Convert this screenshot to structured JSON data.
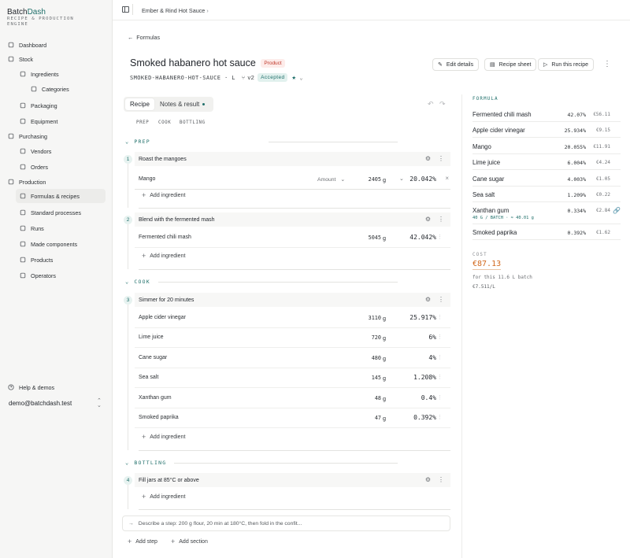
{
  "brand": {
    "name_a": "Batch",
    "name_b": "Dash",
    "subtitle": "RECIPE & PRODUCTION ENGINE"
  },
  "sidebar": {
    "items": [
      {
        "label": "Dashboard",
        "icon": "dashboard-icon"
      },
      {
        "label": "Stock",
        "icon": "box-icon"
      },
      {
        "label": "Ingredients",
        "icon": "leaf-icon"
      },
      {
        "label": "Categories",
        "icon": "tag-icon"
      },
      {
        "label": "Packaging",
        "icon": "package-icon"
      },
      {
        "label": "Equipment",
        "icon": "wrench-icon"
      },
      {
        "label": "Purchasing",
        "icon": "cart-icon"
      },
      {
        "label": "Vendors",
        "icon": "store-icon"
      },
      {
        "label": "Orders",
        "icon": "cart-icon"
      },
      {
        "label": "Production",
        "icon": "factory-icon"
      },
      {
        "label": "Formulas & recipes",
        "icon": "book-icon"
      },
      {
        "label": "Standard processes",
        "icon": "list-icon"
      },
      {
        "label": "Runs",
        "icon": "layers-icon"
      },
      {
        "label": "Made components",
        "icon": "cube-icon"
      },
      {
        "label": "Products",
        "icon": "product-icon"
      },
      {
        "label": "Operators",
        "icon": "users-icon"
      }
    ],
    "help": "Help & demos",
    "user": "demo@batchdash.test"
  },
  "topbar": {
    "breadcrumb": "Ember & Rind Hot Sauce",
    "sep": "›"
  },
  "page": {
    "back": "Formulas",
    "title": "Smoked habanero hot sauce",
    "type_badge": "Product",
    "sku": "SMOKED-HABANERO-HOT-SAUCE · L",
    "version": "v2",
    "status": "Accepted",
    "actions": {
      "edit": "Edit details",
      "sheet": "Recipe sheet",
      "run": "Run this recipe"
    }
  },
  "tabs": {
    "recipe": "Recipe",
    "notes": "Notes & result"
  },
  "jump": [
    "PREP",
    "COOK",
    "BOTTLING"
  ],
  "sections": [
    {
      "name": "PREP",
      "steps": [
        {
          "num": "1",
          "title": "Roast the mangoes",
          "ingredients": [
            {
              "name": "Mango",
              "amount_label": "Amount",
              "amount": "2405",
              "unit": "g",
              "pct": "20.042%"
            }
          ]
        },
        {
          "num": "2",
          "title": "Blend with the fermented mash",
          "ingredients": [
            {
              "name": "Fermented chili mash",
              "amount": "5045",
              "unit": "g",
              "pct": "42.042%"
            }
          ]
        }
      ]
    },
    {
      "name": "COOK",
      "steps": [
        {
          "num": "3",
          "title": "Simmer for 20 minutes",
          "ingredients": [
            {
              "name": "Apple cider vinegar",
              "amount": "3110",
              "unit": "g",
              "pct": "25.917%"
            },
            {
              "name": "Lime juice",
              "amount": "720",
              "unit": "g",
              "pct": "6%"
            },
            {
              "name": "Cane sugar",
              "amount": "480",
              "unit": "g",
              "pct": "4%"
            },
            {
              "name": "Sea salt",
              "amount": "145",
              "unit": "g",
              "pct": "1.208%"
            },
            {
              "name": "Xanthan gum",
              "amount": "48",
              "unit": "g",
              "pct": "0.4%"
            },
            {
              "name": "Smoked paprika",
              "amount": "47",
              "unit": "g",
              "pct": "0.392%"
            }
          ]
        }
      ]
    },
    {
      "name": "BOTTLING",
      "steps": [
        {
          "num": "4",
          "title": "Fill jars at 85°C or above",
          "ingredients": []
        }
      ]
    }
  ],
  "add_ingredient": "Add ingredient",
  "compose_placeholder": "Describe a step: 200 g flour, 20 min at 180°C, then fold in the confit...",
  "footer": {
    "add_step": "Add step",
    "add_section": "Add section"
  },
  "formula": {
    "label": "FORMULA",
    "rows": [
      {
        "name": "Fermented chili mash",
        "pct": "42.07%",
        "cost": "€56.11"
      },
      {
        "name": "Apple cider vinegar",
        "pct": "25.934%",
        "cost": "€9.15"
      },
      {
        "name": "Mango",
        "pct": "20.055%",
        "cost": "€11.91"
      },
      {
        "name": "Lime juice",
        "pct": "6.004%",
        "cost": "€4.24"
      },
      {
        "name": "Cane sugar",
        "pct": "4.003%",
        "cost": "€1.05"
      },
      {
        "name": "Sea salt",
        "pct": "1.209%",
        "cost": "€0.22"
      },
      {
        "name": "Xanthan gum",
        "sub": "40 G / BATCH · ≈ 40.01 g",
        "pct": "0.334%",
        "cost": "€2.84"
      },
      {
        "name": "Smoked paprika",
        "pct": "0.392%",
        "cost": "€1.62"
      }
    ],
    "cost_label": "COST",
    "cost_total": "€87.13",
    "cost_note": "for this 11.6 L batch",
    "cost_per": "€7.511/L"
  },
  "colors": {
    "accent": "#1f6f6a",
    "cost": "#d2691e",
    "badge_product_bg": "#fdecea",
    "badge_product_fg": "#c0392b"
  }
}
